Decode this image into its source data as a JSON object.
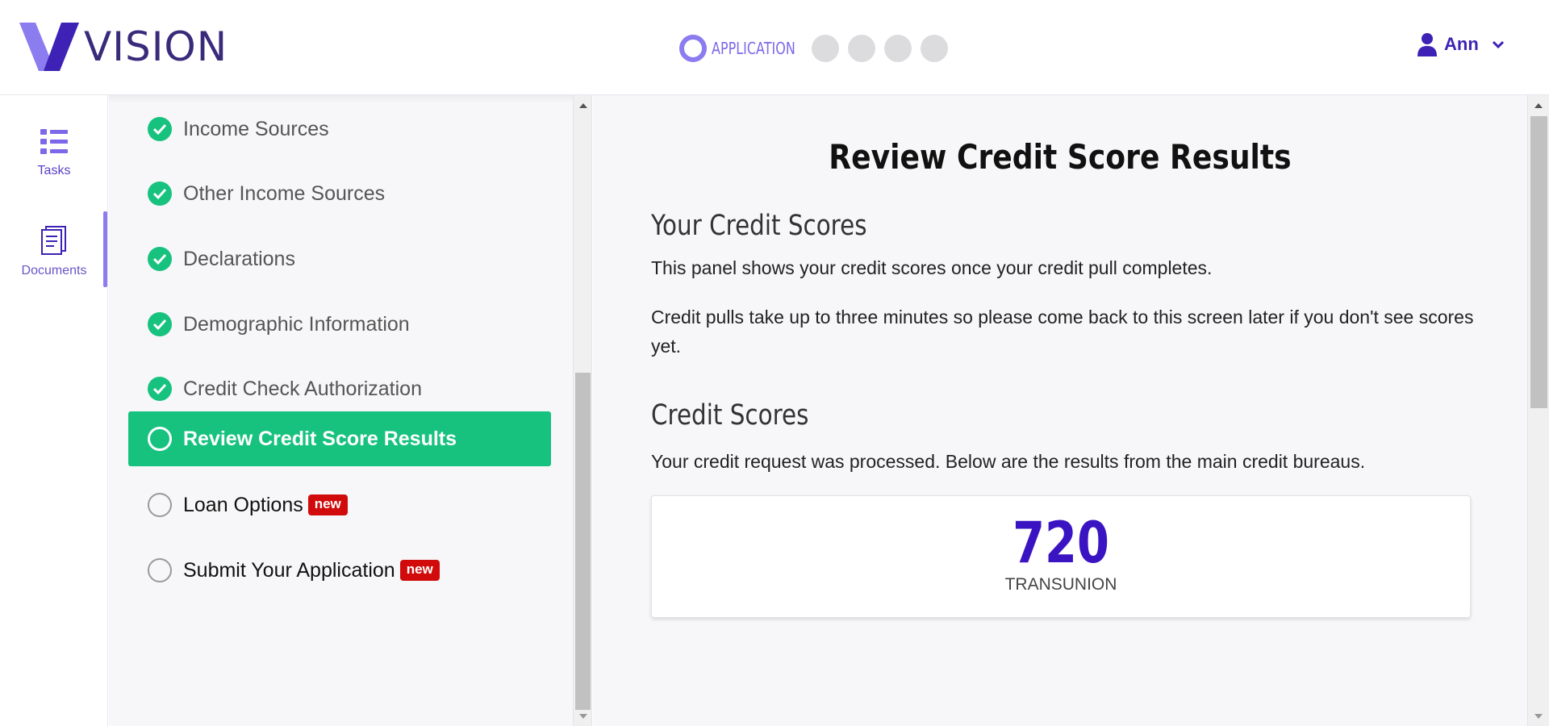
{
  "app": {
    "logo_text": "VISION",
    "brand_color": "#3d22b5",
    "accent_color": "#8b7cf0",
    "success_color": "#17c27f",
    "badge_color": "#d10b0b"
  },
  "header": {
    "progress_current_label": "APPLICATION",
    "progress_remaining_steps": 4,
    "user_name": "Ann"
  },
  "rail": {
    "items": [
      {
        "label": "Tasks",
        "icon": "list-icon",
        "active": true
      },
      {
        "label": "Documents",
        "icon": "document-icon",
        "active": false
      }
    ]
  },
  "tasks": {
    "items": [
      {
        "label": "Income Sources",
        "status": "complete"
      },
      {
        "label": "Other Income Sources",
        "status": "complete"
      },
      {
        "label": "Declarations",
        "status": "complete"
      },
      {
        "label": "Demographic Information",
        "status": "complete"
      },
      {
        "label": "Credit Check Authorization",
        "status": "complete"
      },
      {
        "label": "Review Credit Score Results",
        "status": "active"
      },
      {
        "label": "Loan Options",
        "status": "pending",
        "badge": "new"
      },
      {
        "label": "Submit Your Application",
        "status": "pending",
        "badge": "new"
      }
    ]
  },
  "main": {
    "title": "Review Credit Score Results",
    "section1_heading": "Your Credit Scores",
    "section1_para1": "This panel shows your credit scores once your credit pull completes.",
    "section1_para2": "Credit pulls take up to three minutes so please come back to this screen later if you don't see scores yet.",
    "section2_heading": "Credit Scores",
    "section2_para": "Your credit request was processed. Below are the results from the main credit bureaus.",
    "score": {
      "value": "720",
      "bureau": "TRANSUNION"
    }
  }
}
